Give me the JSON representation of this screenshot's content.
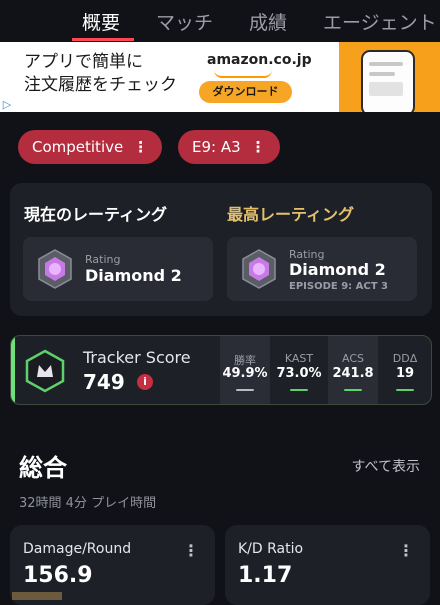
{
  "tabs": [
    "概要",
    "マッチ",
    "成績",
    "エージェント"
  ],
  "ad": {
    "line1": "アプリで簡単に",
    "line2": "注文履歴をチェック",
    "brand": "amazon.co.jp",
    "button": "ダウンロード",
    "info_icon": "▷"
  },
  "filters": {
    "mode": "Competitive",
    "act": "E9: A3",
    "dots": "⋮"
  },
  "rating": {
    "current_title": "現在のレーティング",
    "peak_title": "最高レーティング",
    "current": {
      "label": "Rating",
      "value": "Diamond 2"
    },
    "peak": {
      "label": "Rating",
      "value": "Diamond 2",
      "episode": "EPISODE 9: ACT 3"
    }
  },
  "tracker": {
    "label": "Tracker Score",
    "value": "749",
    "info": "i",
    "stats": [
      {
        "label": "勝率",
        "value": "49.9%",
        "bar": "#b8bac4"
      },
      {
        "label": "KAST",
        "value": "73.0%",
        "bar": "#5dd16a"
      },
      {
        "label": "ACS",
        "value": "241.8",
        "bar": "#5dd16a"
      },
      {
        "label": "DDΔ",
        "value": "19",
        "bar": "#5dd16a"
      }
    ]
  },
  "overview": {
    "title": "総合",
    "show_all": "すべて表示",
    "playtime": "32時間 4分 プレイ時間"
  },
  "cards": [
    {
      "label": "Damage/Round",
      "value": "156.9"
    },
    {
      "label": "K/D Ratio",
      "value": "1.17"
    }
  ],
  "colors": {
    "accent": "#ff4655",
    "pill": "#b42d3f",
    "peak_gold": "#e3c06c",
    "good": "#5dd16a"
  }
}
